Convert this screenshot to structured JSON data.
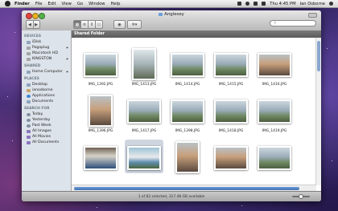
{
  "menubar": {
    "items": [
      "Finder",
      "File",
      "Edit",
      "View",
      "Go",
      "Window",
      "Help"
    ],
    "clock": "Thu 4:45 PM",
    "user": "Ian Osborne"
  },
  "window": {
    "title": "Anglesey",
    "search_placeholder": "",
    "section_header": "Shared Folder",
    "status": "1 of 82 selected, 317.48 GB available"
  },
  "sidebar": {
    "sections": [
      {
        "heading": "DEVICES",
        "items": [
          {
            "label": "iDisk",
            "icon": "idisk-icon",
            "eject": false
          },
          {
            "label": "Pogoplug",
            "icon": "drive-icon",
            "eject": true
          },
          {
            "label": "Macintosh HD",
            "icon": "hd-icon",
            "eject": false
          },
          {
            "label": "KINGSTON",
            "icon": "usb-icon",
            "eject": true
          }
        ]
      },
      {
        "heading": "SHARED",
        "items": [
          {
            "label": "Home Computer",
            "icon": "computer-icon",
            "eject": true
          }
        ]
      },
      {
        "heading": "PLACES",
        "items": [
          {
            "label": "Desktop",
            "icon": "desktop-icon",
            "eject": false
          },
          {
            "label": "ianosborne",
            "icon": "home-icon",
            "eject": false
          },
          {
            "label": "Applications",
            "icon": "applications-icon",
            "eject": false
          },
          {
            "label": "Documents",
            "icon": "documents-icon",
            "eject": false
          }
        ]
      },
      {
        "heading": "SEARCH FOR",
        "items": [
          {
            "label": "Today",
            "icon": "clock-icon",
            "eject": false
          },
          {
            "label": "Yesterday",
            "icon": "clock-icon",
            "eject": false
          },
          {
            "label": "Past Week",
            "icon": "clock-icon",
            "eject": false
          },
          {
            "label": "All Images",
            "icon": "smart-folder-icon",
            "eject": false
          },
          {
            "label": "All Movies",
            "icon": "smart-folder-icon",
            "eject": false
          },
          {
            "label": "All Documents",
            "icon": "smart-folder-icon",
            "eject": false
          }
        ]
      }
    ]
  },
  "files": [
    {
      "name": "IMG_1392.JPG",
      "orientation": "land",
      "tone": "sea"
    },
    {
      "name": "IMG_1413.JPG",
      "orientation": "portrait",
      "tone": "tall"
    },
    {
      "name": "IMG_1414.JPG",
      "orientation": "land",
      "tone": "sea"
    },
    {
      "name": "IMG_1415.JPG",
      "orientation": "land",
      "tone": "sea"
    },
    {
      "name": "IMG_1416.JPG",
      "orientation": "land",
      "tone": "face"
    },
    {
      "name": "IMG_1396.JPG",
      "orientation": "portrait",
      "tone": "face"
    },
    {
      "name": "IMG_1417.JPG",
      "orientation": "land",
      "tone": "sea"
    },
    {
      "name": "IMG_1398.JPG",
      "orientation": "land",
      "tone": "sea"
    },
    {
      "name": "IMG_1418.JPG",
      "orientation": "land",
      "tone": "sea"
    },
    {
      "name": "IMG_1419.JPG",
      "orientation": "land",
      "tone": "sea"
    },
    {
      "name": "",
      "orientation": "land",
      "tone": "table"
    },
    {
      "name": "",
      "orientation": "land",
      "tone": "sign",
      "selected": true
    },
    {
      "name": "",
      "orientation": "portrait",
      "tone": "face"
    },
    {
      "name": "",
      "orientation": "land",
      "tone": "face"
    },
    {
      "name": "",
      "orientation": "land",
      "tone": "sea"
    }
  ]
}
